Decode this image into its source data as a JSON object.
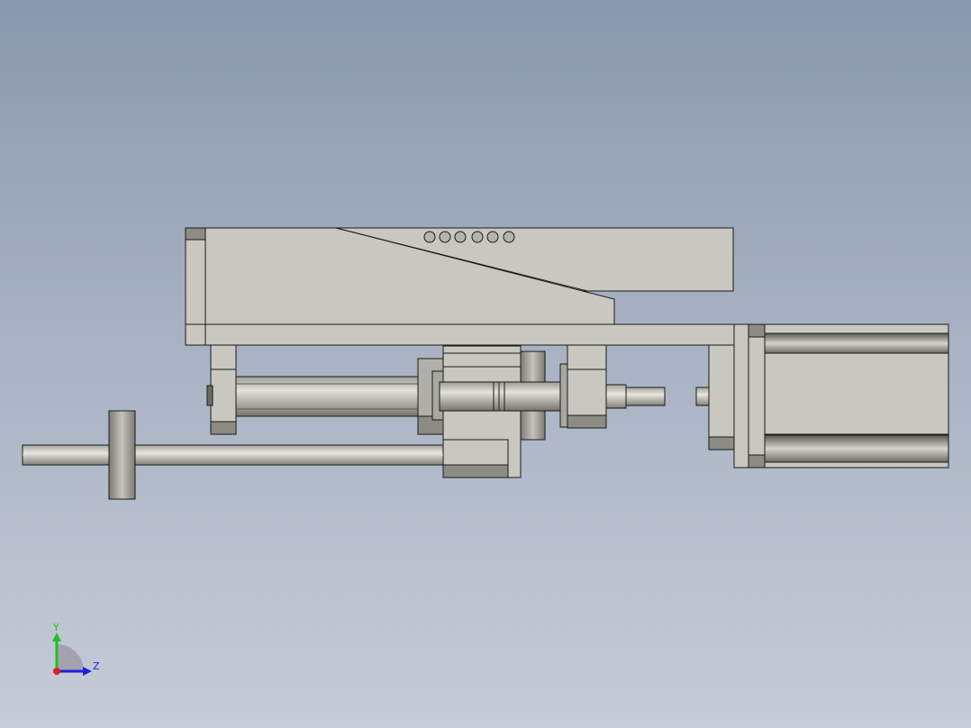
{
  "viewport": {
    "background_top": "#8a98ad",
    "background_bottom": "#c6ccd8"
  },
  "model": {
    "part_fill": "#c8c8c0",
    "part_stroke": "#1a1a1a",
    "shade_fill": "#8c8c84",
    "shaft_highlight": "#e4e4dc"
  },
  "triad": {
    "y_label": "Y",
    "z_label": "Z",
    "x_color": "#e02020",
    "y_color": "#20c020",
    "z_color": "#2020e0"
  }
}
